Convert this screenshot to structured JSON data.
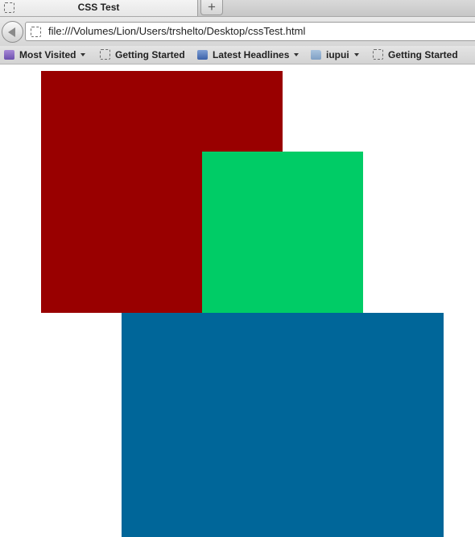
{
  "tab": {
    "title": "CSS Test",
    "new_tab_label": "+"
  },
  "navigation": {
    "url": "file:///Volumes/Lion/Users/trshelto/Desktop/cssTest.html"
  },
  "bookmarks": [
    {
      "label": "Most Visited",
      "icon": "most-visited-icon",
      "dropdown": true
    },
    {
      "label": "Getting Started",
      "icon": "page-icon",
      "dropdown": false
    },
    {
      "label": "Latest Headlines",
      "icon": "rss-icon",
      "dropdown": true
    },
    {
      "label": "iupui",
      "icon": "folder-icon",
      "dropdown": true
    },
    {
      "label": "Getting Started",
      "icon": "page-icon",
      "dropdown": false
    }
  ],
  "boxes": {
    "red": {
      "color": "#990000"
    },
    "green": {
      "color": "#00cc66"
    },
    "blue": {
      "color": "#006699"
    }
  }
}
